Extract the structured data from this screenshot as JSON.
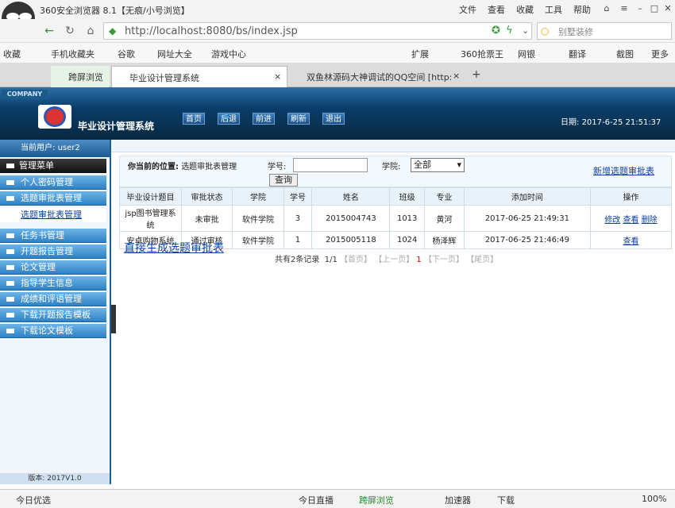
{
  "browser": {
    "title": "360安全浏览器 8.1【无痕/小号浏览】",
    "menu": [
      "文件",
      "查看",
      "收藏",
      "工具",
      "帮助"
    ],
    "url": "http://localhost:8080/bs/index.jsp",
    "search_placeholder": "别墅装修",
    "bookmarks": [
      "收藏",
      "手机收藏夹",
      "谷歌",
      "网址大全",
      "游戏中心",
      "扩展",
      "360抢票王",
      "网银",
      "翻译",
      "截图",
      "更多"
    ],
    "tabs": [
      "跨屏浏览",
      "毕业设计管理系统",
      "双鱼林源码大神调试的QQ空间 [http:"
    ]
  },
  "app": {
    "company": "COMPANY",
    "title": "毕业设计管理系统",
    "nav": [
      "首页",
      "后退",
      "前进",
      "刷新",
      "退出"
    ],
    "date_label": "日期:",
    "date_value": "2017-6-25 21:51:37"
  },
  "sidebar": {
    "current_user_label": "当前用户:",
    "current_user": "user2",
    "menu_head": "管理菜单",
    "items": [
      "个人密码管理",
      "选题审批表管理",
      "选题审批表管理",
      "任务书管理",
      "开题报告管理",
      "论文管理",
      "指导学生信息",
      "成绩和评语管理",
      "下载开题报告模板",
      "下载论文模板"
    ],
    "version": "版本: 2017V1.0"
  },
  "filter": {
    "location_label": "你当前的位置:",
    "location_value": "选题审批表管理",
    "xh_label": "学号:",
    "xh_value": "",
    "query": "查询",
    "xy_label": "学院:",
    "xy_value": "全部",
    "add_link": "新增选题审批表"
  },
  "table": {
    "headers": [
      "毕业设计题目",
      "审批状态",
      "学院",
      "学号",
      "姓名",
      "班级",
      "专业",
      "添加时间",
      "操作"
    ],
    "rows": [
      {
        "title": "jsp图书管理系统",
        "status": "未审批",
        "college": "软件学院",
        "no": "3",
        "sid": "2015004743",
        "cls": "1013",
        "major": "黄河",
        "time": "2017-06-25 21:49:31",
        "ops": [
          "修改",
          "查看",
          "删除"
        ]
      },
      {
        "title": "安卓购物系统",
        "status": "通过审核",
        "college": "软件学院",
        "no": "1",
        "sid": "2015005118",
        "cls": "1024",
        "major": "杨泽辉",
        "time": "2017-06-25 21:46:49",
        "ops": [
          "查看"
        ]
      }
    ]
  },
  "gen_link": "直接生成选题审批表",
  "pager": {
    "total": "共有2条记录",
    "pages": "1/1",
    "first": "【首页】",
    "prev": "【上一页】",
    "cur": "1",
    "next": "【下一页】",
    "last": "【尾页】"
  },
  "status": {
    "items": [
      "今日优选",
      "今日直播",
      "跨屏浏览",
      "加速器",
      "下载"
    ],
    "zoom": "100%"
  }
}
